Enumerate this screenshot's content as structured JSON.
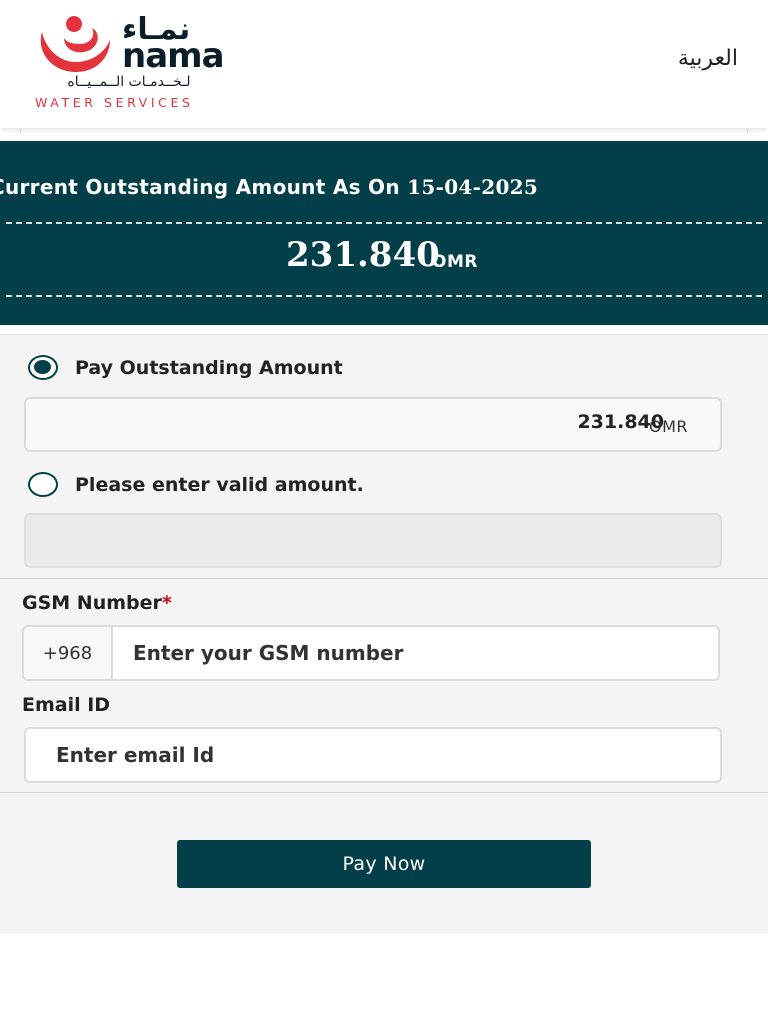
{
  "brand": {
    "name_ar": "نمـاء",
    "name_en": "nama",
    "subtitle_ar": "لـخــدمـات الــمــيــاه",
    "tagline": "WATER SERVICES",
    "primary_color": "#033f49",
    "accent_color": "#e3343d"
  },
  "header": {
    "language_link": "العربية"
  },
  "banner": {
    "title_prefix": "Current Outstanding Amount As On",
    "date": "15-04-2025",
    "amount": "231.840",
    "currency": "OMR"
  },
  "payment_options": {
    "outstanding": {
      "label": "Pay Outstanding Amount",
      "selected": true,
      "amount": "231.840",
      "currency": "OMR"
    },
    "custom": {
      "label": "Please enter valid amount.",
      "selected": false,
      "value": ""
    }
  },
  "gsm": {
    "label": "GSM Number",
    "required_mark": "*",
    "prefix": "+968",
    "placeholder": "Enter your GSM number"
  },
  "email": {
    "label": "Email ID",
    "placeholder": "Enter email Id"
  },
  "pay_button": {
    "label": "Pay Now"
  }
}
